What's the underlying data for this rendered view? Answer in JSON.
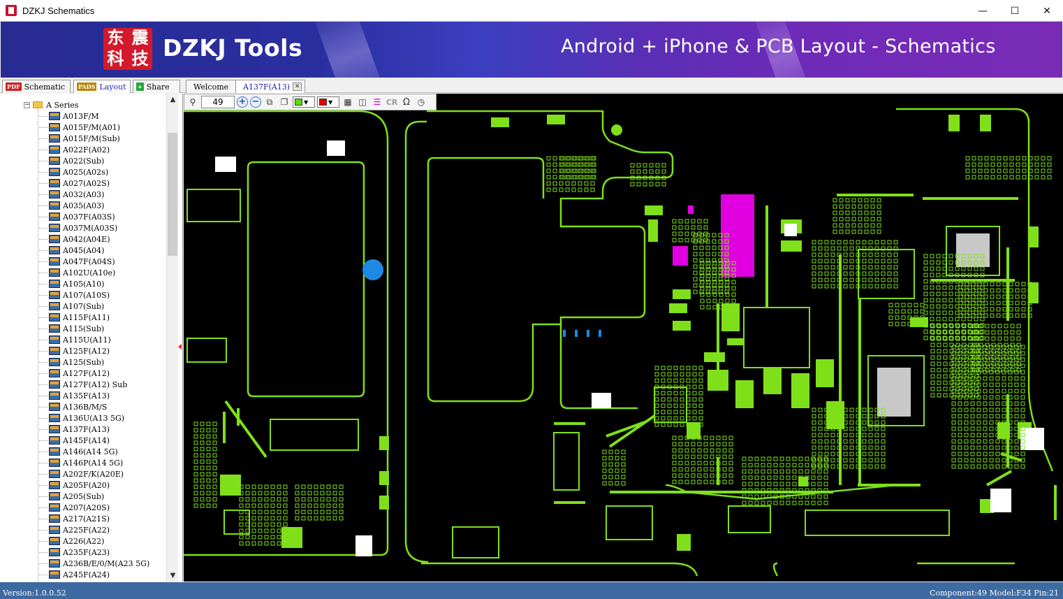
{
  "window": {
    "title": "DZKJ Schematics",
    "minimize": "—",
    "maximize": "☐",
    "close": "✕"
  },
  "banner": {
    "logo_chars": [
      "东",
      "震",
      "科",
      "技"
    ],
    "brand": "DZKJ Tools",
    "tagline": "Android + iPhone & PCB Layout - Schematics"
  },
  "left_tabs": [
    {
      "label": "Schematic",
      "icon": "PDF"
    },
    {
      "label": "Layout",
      "icon": "PADS"
    },
    {
      "label": "Share",
      "icon": "+"
    }
  ],
  "doc_tabs": [
    {
      "label": "Welcome"
    },
    {
      "label": "A137F(A13)"
    }
  ],
  "toolbar": {
    "zoom_value": "49",
    "color1": "#55dd00",
    "color2": "#e00000",
    "cr_label": "CR",
    "omega_label": "Ω"
  },
  "tree": {
    "root_label": "A Series",
    "items": [
      "A013F/M",
      "A015F/M(A01)",
      "A015F/M(Sub)",
      "A022F(A02)",
      "A022(Sub)",
      "A025(A02s)",
      "A027(A02S)",
      "A032(A03)",
      "A035(A03)",
      "A037F(A03S)",
      "A037M(A03S)",
      "A042(A04E)",
      "A045(A04)",
      "A047F(A04S)",
      "A102U(A10e)",
      "A105(A10)",
      "A107(A10S)",
      "A107(Sub)",
      "A115F(A11)",
      "A115(Sub)",
      "A115U(A11)",
      "A125F(A12)",
      "A125(Sub)",
      "A127F(A12)",
      "A127F(A12) Sub",
      "A135F(A13)",
      "A136B/M/S",
      "A136U(A13 5G)",
      "A137F(A13)",
      "A145F(A14)",
      "A146(A14 5G)",
      "A146P(A14 5G)",
      "A202F/K(A20E)",
      "A205F(A20)",
      "A205(Sub)",
      "A207(A20S)",
      "A217(A21S)",
      "A225F(A22)",
      "A226(A22)",
      "A235F(A23)",
      "A236B/E/0/M(A23 5G)",
      "A245F(A24)"
    ]
  },
  "status": {
    "version": "Version:1.0.0.52",
    "info": "Component:49 Model:F34 Pin:21"
  },
  "pcb": {
    "trace_color": "#7fe01a",
    "highlight_color": "#e000e0",
    "marker_color": "#1e88e5"
  }
}
